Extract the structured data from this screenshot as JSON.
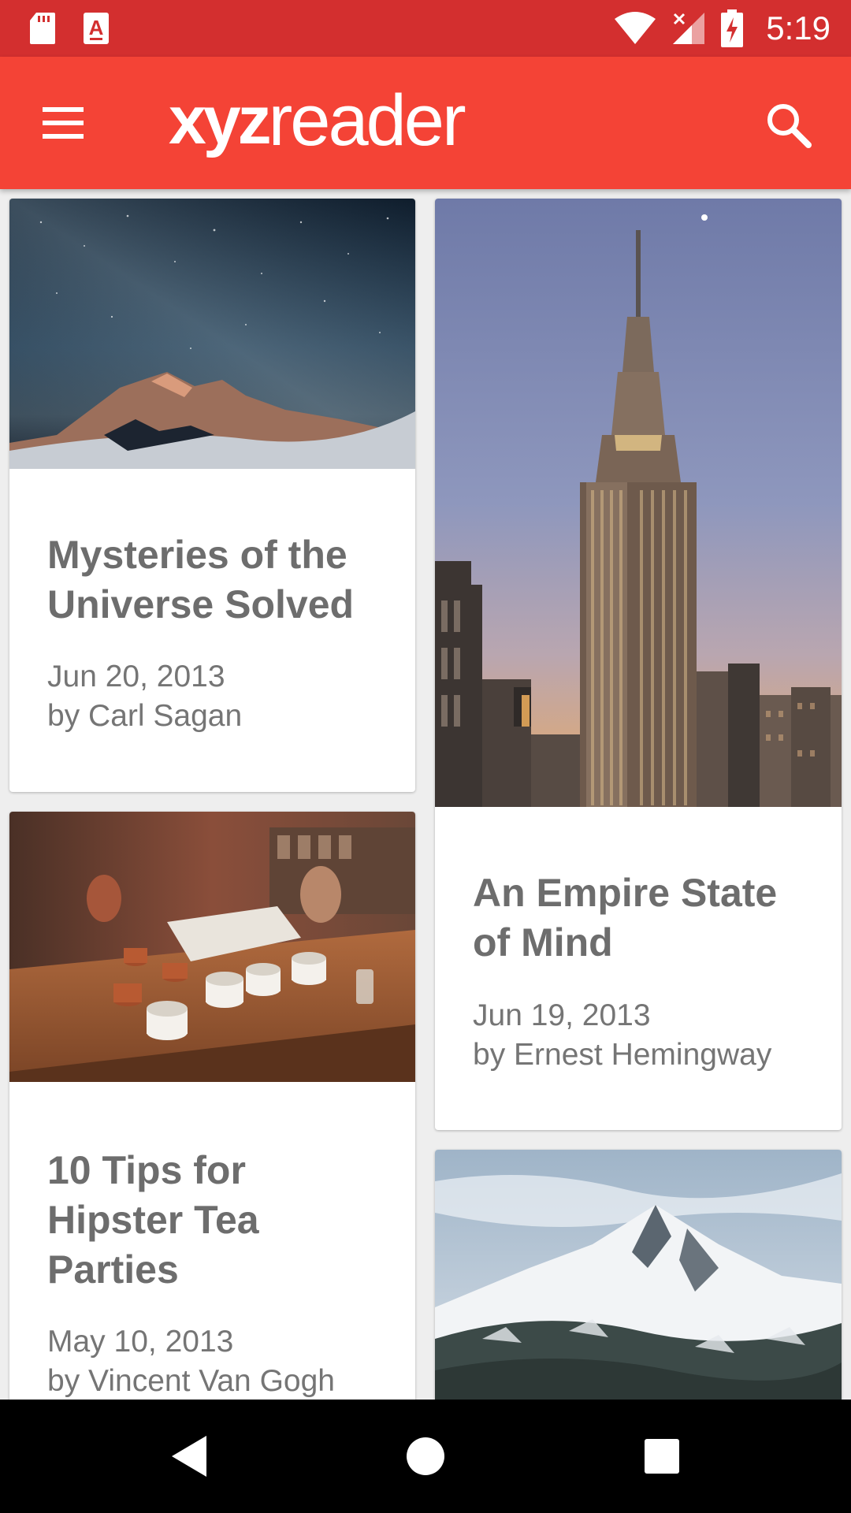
{
  "status_bar": {
    "time": "5:19",
    "icons": [
      "sd-card-icon",
      "app-notification-icon",
      "wifi-icon",
      "cell-signal-icon",
      "battery-charging-icon"
    ]
  },
  "app_bar": {
    "logo_bold": "xyz",
    "logo_regular": "reader",
    "menu_icon": "menu-icon",
    "search_icon": "search-icon"
  },
  "articles": [
    {
      "title": "Mysteries of the Universe Solved",
      "date": "Jun 20, 2013",
      "author": "by Carl Sagan"
    },
    {
      "title": "An Empire State of Mind",
      "date": "Jun 19, 2013",
      "author": "by Ernest Hemingway"
    },
    {
      "title": "10 Tips for Hipster Tea Parties",
      "date": "May 10, 2013",
      "author": "by Vincent Van Gogh"
    }
  ],
  "nav_bar": {
    "icons": [
      "back-icon",
      "home-icon",
      "recents-icon"
    ]
  },
  "colors": {
    "status_bar": "#d32f2f",
    "app_bar": "#f44336",
    "background": "#eeeeee",
    "title_text": "#6d6d6d",
    "meta_text": "#757575"
  }
}
